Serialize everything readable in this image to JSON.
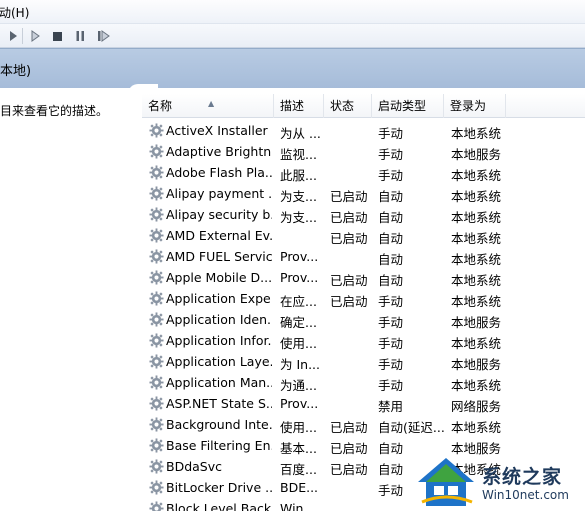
{
  "menubar": {
    "action_label": "动(H)"
  },
  "toolbar": {
    "buttons": [
      {
        "name": "play-icon"
      },
      {
        "name": "play-outline-icon"
      },
      {
        "name": "stop-icon"
      },
      {
        "name": "pause-icon"
      },
      {
        "name": "restart-icon"
      }
    ]
  },
  "band": {
    "title": "本地)"
  },
  "left_pane": {
    "description": "目来查看它的描述。"
  },
  "columns": [
    "名称",
    "描述",
    "状态",
    "启动类型",
    "登录为"
  ],
  "services": [
    {
      "name": "ActiveX Installer ...",
      "desc": "为从 ...",
      "status": "",
      "startup": "手动",
      "logon": "本地系统"
    },
    {
      "name": "Adaptive Brightn...",
      "desc": "监视...",
      "status": "",
      "startup": "手动",
      "logon": "本地服务"
    },
    {
      "name": "Adobe Flash Pla...",
      "desc": "此服...",
      "status": "",
      "startup": "手动",
      "logon": "本地系统"
    },
    {
      "name": "Alipay payment ...",
      "desc": "为支...",
      "status": "已启动",
      "startup": "自动",
      "logon": "本地系统"
    },
    {
      "name": "Alipay security b...",
      "desc": "为支...",
      "status": "已启动",
      "startup": "自动",
      "logon": "本地系统"
    },
    {
      "name": "AMD External Ev...",
      "desc": "",
      "status": "已启动",
      "startup": "自动",
      "logon": "本地系统"
    },
    {
      "name": "AMD FUEL Service",
      "desc": "Prov...",
      "status": "",
      "startup": "自动",
      "logon": "本地系统"
    },
    {
      "name": "Apple Mobile D...",
      "desc": "Prov...",
      "status": "已启动",
      "startup": "自动",
      "logon": "本地系统"
    },
    {
      "name": "Application Expe...",
      "desc": "在应...",
      "status": "已启动",
      "startup": "手动",
      "logon": "本地系统"
    },
    {
      "name": "Application Iden...",
      "desc": "确定...",
      "status": "",
      "startup": "手动",
      "logon": "本地服务"
    },
    {
      "name": "Application Infor...",
      "desc": "使用...",
      "status": "",
      "startup": "手动",
      "logon": "本地系统"
    },
    {
      "name": "Application Laye...",
      "desc": "为 In...",
      "status": "",
      "startup": "手动",
      "logon": "本地服务"
    },
    {
      "name": "Application Man...",
      "desc": "为通...",
      "status": "",
      "startup": "手动",
      "logon": "本地系统"
    },
    {
      "name": "ASP.NET State S...",
      "desc": "Prov...",
      "status": "",
      "startup": "禁用",
      "logon": "网络服务"
    },
    {
      "name": "Background Inte...",
      "desc": "使用...",
      "status": "已启动",
      "startup": "自动(延迟...",
      "logon": "本地系统"
    },
    {
      "name": "Base Filtering En...",
      "desc": "基本...",
      "status": "已启动",
      "startup": "自动",
      "logon": "本地服务"
    },
    {
      "name": "BDdaSvc",
      "desc": "百度...",
      "status": "已启动",
      "startup": "自动",
      "logon": "本地系统"
    },
    {
      "name": "BitLocker Drive ...",
      "desc": "BDE...",
      "status": "",
      "startup": "手动",
      "logon": ""
    },
    {
      "name": "Block Level Back...",
      "desc": "Win...",
      "status": "",
      "startup": "",
      "logon": ""
    }
  ],
  "watermark": {
    "name": "系统之家",
    "url": "Win10net.com"
  },
  "colors": {
    "band": "#a9bfdc",
    "gear": "#8a95a3",
    "watermark_blue": "#1e73c8"
  }
}
